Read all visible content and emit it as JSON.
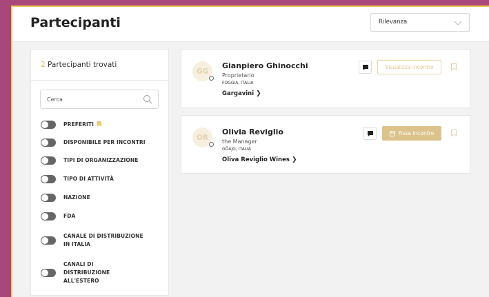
{
  "header": {
    "title": "Partecipanti",
    "sort": {
      "selected": "Rilevanza"
    }
  },
  "filters": {
    "found_count": "2",
    "found_text": "Partecipanti trovati",
    "search_placeholder": "Cerca",
    "toggles": [
      {
        "label": "PREFERITI"
      },
      {
        "label": "DISPONIBILE PER INCONTRI"
      },
      {
        "label": "TIPI DI ORGANIZZAZIONE"
      },
      {
        "label": "TIPO DI ATTIVITÀ"
      },
      {
        "label": "NAZIONE"
      },
      {
        "label": "FDA"
      },
      {
        "label": "CANALE DI DISTRIBUZIONE IN ITALIA"
      },
      {
        "label": "CANALI DI DISTRIBUZIONE ALL'ESTERO"
      }
    ]
  },
  "participants": [
    {
      "initials": "GG",
      "name": "Gianpiero Ghinocchi",
      "role": "Proprietario",
      "location": "FOGGIA, ITALIA",
      "company": "Gargavini",
      "action_label": "Visualizza incontro"
    },
    {
      "initials": "OR",
      "name": "Olivia Reviglio",
      "role": "the Manager",
      "location": "GÖAJG, ITALIA",
      "company": "Oliva Reviglio Wines",
      "action_label": "Fissa incontro"
    }
  ],
  "colors": {
    "accent": "#dcc38c",
    "frame": "#a8477a",
    "border_highlight": "#efc85a"
  }
}
